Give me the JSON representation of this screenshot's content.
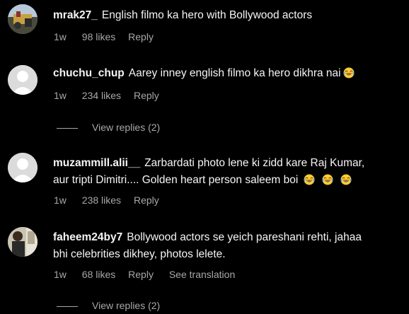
{
  "comments": [
    {
      "username": "mrak27_",
      "text": "English filmo ka hero with Bollywood actors",
      "time": "1w",
      "likes": "98 likes",
      "reply": "Reply",
      "emoji_count": 0,
      "avatar": "photo"
    },
    {
      "username": "chuchu_chup",
      "text": "Aarey inney english filmo ka hero dikhra nai",
      "time": "1w",
      "likes": "234 likes",
      "reply": "Reply",
      "emoji_count": 1,
      "avatar": "default",
      "view_replies": "View replies (2)"
    },
    {
      "username": "muzammill.alii__",
      "text_line1": "Zarbardati photo lene ki zidd kare Raj Kumar,",
      "text_line2": "aur tripti Dimitri.... Golden heart person saleem boi",
      "time": "1w",
      "likes": "238 likes",
      "reply": "Reply",
      "emoji_count": 3,
      "avatar": "default"
    },
    {
      "username": "faheem24by7",
      "text_line1": "Bollywood actors se yeich pareshani rehti, jahaa",
      "text_line2": "bhi celebrities dikhey, photos lelete.",
      "time": "1w",
      "likes": "68 likes",
      "reply": "Reply",
      "translate": "See translation",
      "avatar": "photo",
      "view_replies": "View replies (2)"
    }
  ],
  "emoji_icon": "face-with-tears-of-joy-icon",
  "colors": {
    "background": "#000000",
    "text": "#f5f5f5",
    "secondary": "#a8a8a8",
    "default_avatar": "#dbdbdb"
  }
}
